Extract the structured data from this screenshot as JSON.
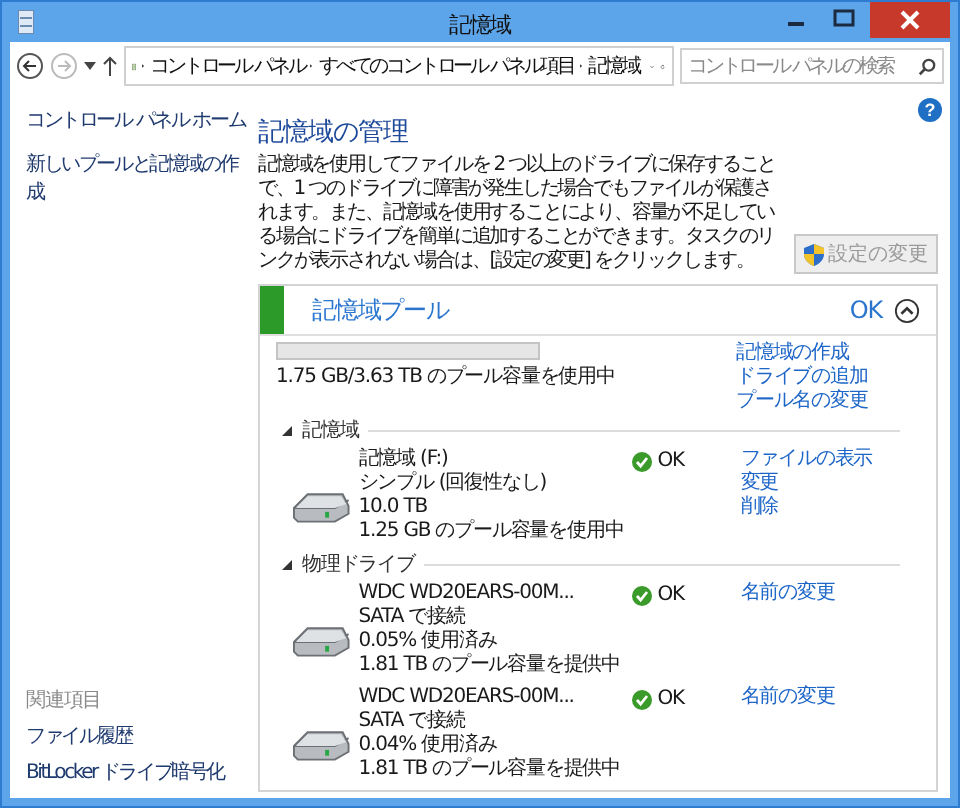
{
  "window": {
    "title": "記憶域"
  },
  "address_bar": {
    "breadcrumbs": [
      "コントロール パネル",
      "すべてのコントロール パネル項目",
      "記憶域"
    ]
  },
  "search": {
    "placeholder": "コントロール パネルの検索"
  },
  "help": "?",
  "sidebar": {
    "links": [
      "コントロール パネル ホーム",
      "新しいプールと記憶域の作成"
    ],
    "related_heading": "関連項目",
    "related_links": [
      "ファイル履歴",
      "BitLocker ドライブ暗号化"
    ]
  },
  "main": {
    "heading": "記憶域の管理",
    "description": "記憶域を使用してファイルを 2 つ以上のドライブに保存することで、1 つのドライブに障害が発生した場合でもファイルが保護されます。また、記憶域を使用することにより、容量が不足している場合にドライブを簡単に追加することができます。タスクのリンクが表示されない場合は、[設定の変更] をクリックします。",
    "settings_button": {
      "label": "設定の変更",
      "disabled": true
    }
  },
  "pool": {
    "title": "記憶域プール",
    "status": "OK",
    "expanded": true,
    "level": 0,
    "usage_text": "1.75 GB/3.63 TB のプール容量を使用中",
    "tasks": [
      "記憶域の作成",
      "ドライブの追加",
      "プール名の変更"
    ],
    "sections": [
      {
        "title": "記憶域",
        "expanded": true,
        "items": [
          {
            "lines": [
              "記憶域 (F:)",
              "シンプル (回復性なし)",
              "10.0 TB",
              "1.25 GB のプール容量を使用中"
            ],
            "status": "OK",
            "actions": [
              "ファイルの表示",
              "変更",
              "削除"
            ]
          }
        ]
      },
      {
        "title": "物理ドライブ",
        "expanded": true,
        "items": [
          {
            "lines": [
              "WDC WD20EARS-00M...",
              "SATA で接続",
              "0.05% 使用済み",
              "1.81 TB のプール容量を提供中"
            ],
            "status": "OK",
            "actions": [
              "名前の変更"
            ]
          },
          {
            "lines": [
              "WDC WD20EARS-00M...",
              "SATA で接続",
              "0.04% 使用済み",
              "1.81 TB のプール容量を提供中"
            ],
            "status": "OK",
            "actions": [
              "名前の変更"
            ]
          }
        ]
      }
    ]
  }
}
